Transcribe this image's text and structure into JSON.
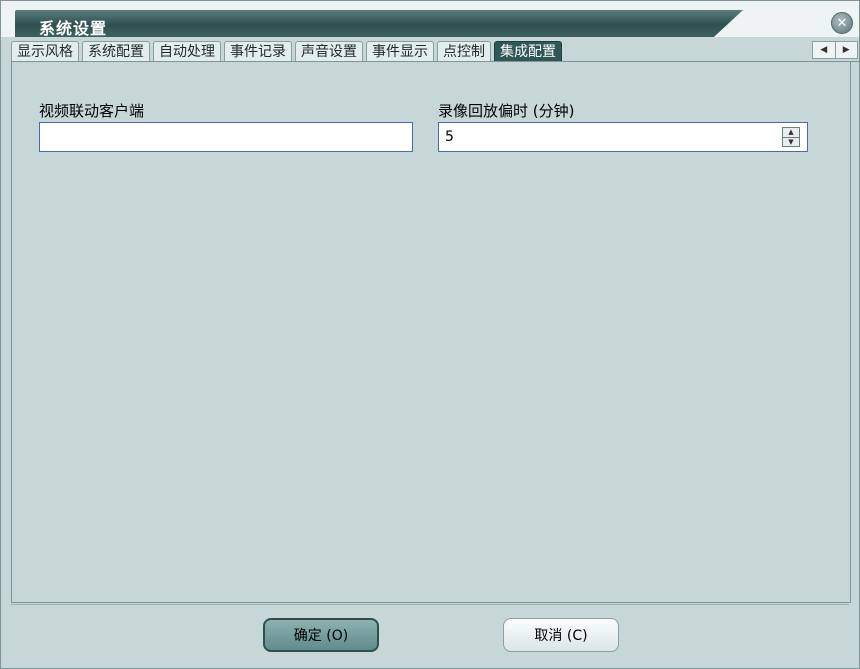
{
  "window": {
    "title": "系统设置",
    "close_icon": "close-icon"
  },
  "tabs": [
    {
      "label": "显示风格"
    },
    {
      "label": "系统配置"
    },
    {
      "label": "自动处理"
    },
    {
      "label": "事件记录"
    },
    {
      "label": "声音设置"
    },
    {
      "label": "事件显示"
    },
    {
      "label": "点控制"
    },
    {
      "label": "集成配置",
      "active": true
    }
  ],
  "tab_scroll": {
    "left_icon": "arrow-left-icon",
    "right_icon": "arrow-right-icon"
  },
  "fields": {
    "video_client": {
      "label": "视频联动客户端",
      "value": ""
    },
    "replay_offset": {
      "label": "录像回放偏时 (分钟)",
      "value": "5"
    }
  },
  "buttons": {
    "ok": "确定 (O)",
    "cancel": "取消 (C)"
  },
  "colors": {
    "title_bar": "#2e5050",
    "active_tab": "#2f5757",
    "panel_bg": "#c7d7d7",
    "input_border": "#4a6bb0"
  }
}
